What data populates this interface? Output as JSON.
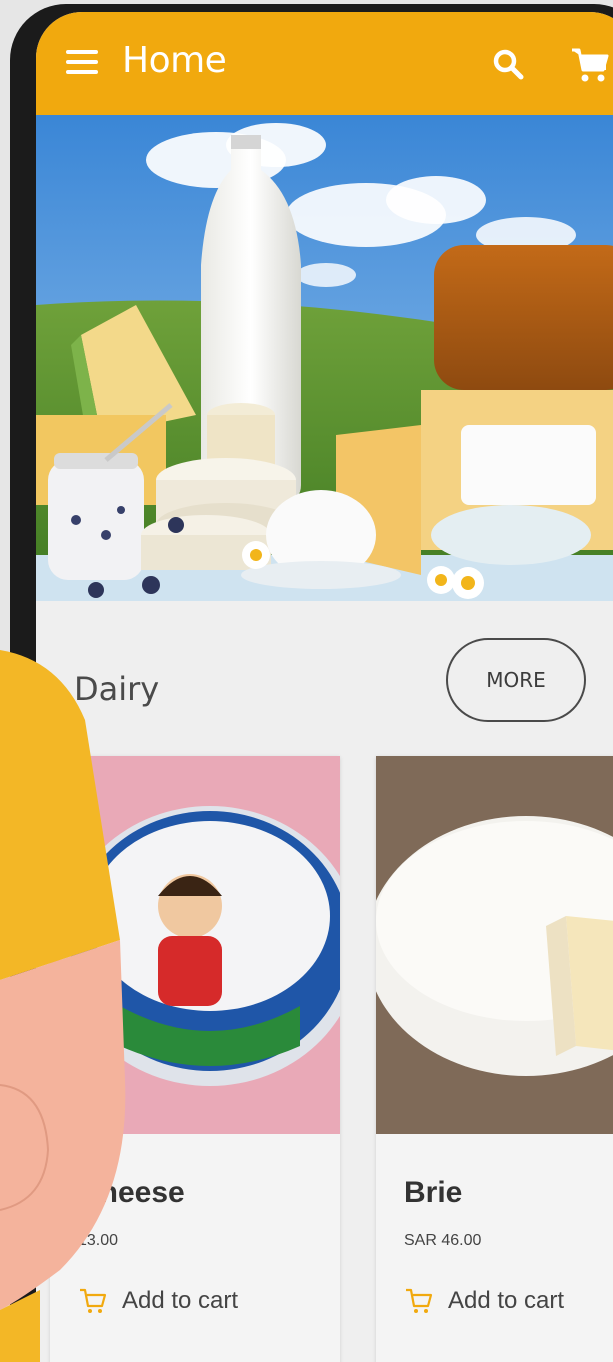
{
  "app_bar": {
    "title": "Home",
    "color": "#f1a90e",
    "icons": [
      "menu-icon",
      "search-icon",
      "cart-icon"
    ]
  },
  "section": {
    "title": "Dairy",
    "more_label": "MORE"
  },
  "products": [
    {
      "name": "Cheese",
      "price": "13.00",
      "add_to_cart": "Add to cart"
    },
    {
      "name": "Brie",
      "price": "SAR 46.00",
      "add_to_cart": "Add to cart"
    }
  ],
  "colors": {
    "accent": "#f1a90e",
    "cart_icon": "#f1a90e",
    "background": "#efefef"
  }
}
